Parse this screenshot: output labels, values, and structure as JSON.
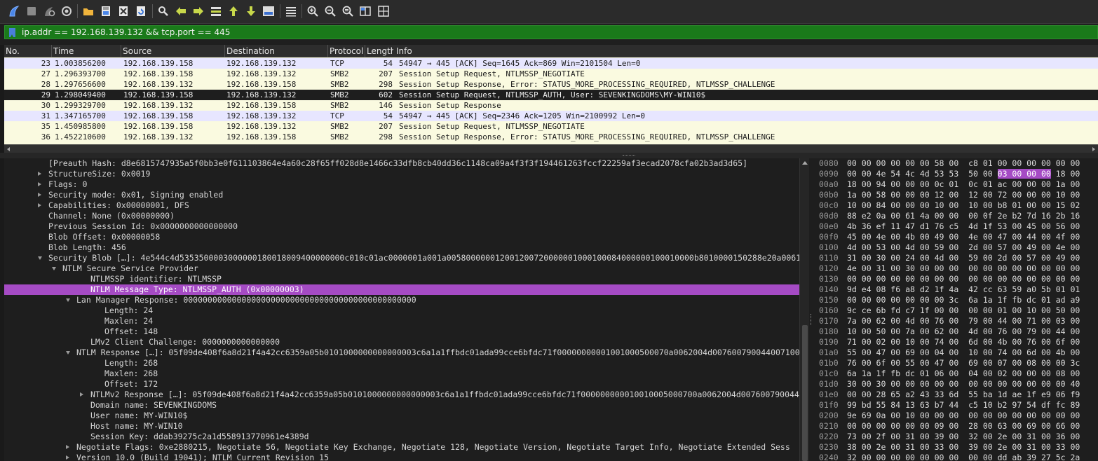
{
  "toolbar": {
    "buttons": [
      {
        "icon": "shark-fin-start-icon"
      },
      {
        "icon": "stop-capture-icon"
      },
      {
        "icon": "restart-capture-icon"
      },
      {
        "icon": "capture-options-icon"
      },
      {
        "icon": "open-file-icon"
      },
      {
        "icon": "save-file-icon"
      },
      {
        "icon": "close-file-icon"
      },
      {
        "icon": "reload-file-icon"
      },
      {
        "icon": "find-packet-icon"
      },
      {
        "icon": "go-back-icon"
      },
      {
        "icon": "go-forward-icon"
      },
      {
        "icon": "go-to-packet-icon"
      },
      {
        "icon": "go-first-packet-icon"
      },
      {
        "icon": "go-last-packet-icon"
      },
      {
        "icon": "auto-scroll-icon"
      },
      {
        "icon": "colorize-icon"
      },
      {
        "icon": "zoom-in-icon"
      },
      {
        "icon": "zoom-out-icon"
      },
      {
        "icon": "zoom-normal-icon"
      },
      {
        "icon": "resize-columns-icon"
      },
      {
        "icon": "expand-subtrees-icon"
      }
    ]
  },
  "filter": {
    "value": "ip.addr == 192.168.139.132 && tcp.port == 445",
    "background_color": "#1a7a1a"
  },
  "packet_list": {
    "columns": [
      "No.",
      "Time",
      "Source",
      "Destination",
      "Protocol",
      "Length",
      "Info"
    ],
    "rows": [
      {
        "no": "23",
        "time": "1.003856200",
        "source": "192.168.139.158",
        "destination": "192.168.139.132",
        "protocol": "TCP",
        "length": "54",
        "info": "54947 → 445 [ACK] Seq=1645 Ack=869 Win=2101504 Len=0",
        "kind": "tcp"
      },
      {
        "no": "27",
        "time": "1.296393700",
        "source": "192.168.139.158",
        "destination": "192.168.139.132",
        "protocol": "SMB2",
        "length": "207",
        "info": "Session Setup Request, NTLMSSP_NEGOTIATE",
        "kind": "smb"
      },
      {
        "no": "28",
        "time": "1.297656600",
        "source": "192.168.139.132",
        "destination": "192.168.139.158",
        "protocol": "SMB2",
        "length": "298",
        "info": "Session Setup Response, Error: STATUS_MORE_PROCESSING_REQUIRED, NTLMSSP_CHALLENGE",
        "kind": "smb"
      },
      {
        "no": "29",
        "time": "1.298049400",
        "source": "192.168.139.158",
        "destination": "192.168.139.132",
        "protocol": "SMB2",
        "length": "602",
        "info": "Session Setup Request, NTLMSSP_AUTH, User: SEVENKINGDOMS\\MY-WIN10$",
        "kind": "sel"
      },
      {
        "no": "30",
        "time": "1.299329700",
        "source": "192.168.139.132",
        "destination": "192.168.139.158",
        "protocol": "SMB2",
        "length": "146",
        "info": "Session Setup Response",
        "kind": "smb"
      },
      {
        "no": "31",
        "time": "1.347165700",
        "source": "192.168.139.158",
        "destination": "192.168.139.132",
        "protocol": "TCP",
        "length": "54",
        "info": "54947 → 445 [ACK] Seq=2346 Ack=1205 Win=2100992 Len=0",
        "kind": "tcp"
      },
      {
        "no": "35",
        "time": "1.450985800",
        "source": "192.168.139.158",
        "destination": "192.168.139.132",
        "protocol": "SMB2",
        "length": "207",
        "info": "Session Setup Request, NTLMSSP_NEGOTIATE",
        "kind": "smb"
      },
      {
        "no": "36",
        "time": "1.452210600",
        "source": "192.168.139.132",
        "destination": "192.168.139.158",
        "protocol": "SMB2",
        "length": "298",
        "info": "Session Setup Response, Error: STATUS_MORE_PROCESSING_REQUIRED, NTLMSSP_CHALLENGE",
        "kind": "smb"
      }
    ]
  },
  "details": {
    "rows": [
      {
        "indent": 1,
        "arrow": "none",
        "text": "[Preauth Hash: d8e6815747935a5f0bb3e0f611103864e4a60c28f65ff028d8e1466c33dfb8cb40dd36c1148ca09a4f3f3f194461263fccf22259af3ecad2078cfa02b3ad3d65]"
      },
      {
        "indent": 1,
        "arrow": "right",
        "text": "StructureSize: 0x0019"
      },
      {
        "indent": 1,
        "arrow": "right",
        "text": "Flags: 0"
      },
      {
        "indent": 1,
        "arrow": "right",
        "text": "Security mode: 0x01, Signing enabled"
      },
      {
        "indent": 1,
        "arrow": "right",
        "text": "Capabilities: 0x00000001, DFS"
      },
      {
        "indent": 1,
        "arrow": "none",
        "text": "Channel: None (0x00000000)"
      },
      {
        "indent": 1,
        "arrow": "none",
        "text": "Previous Session Id: 0x0000000000000000"
      },
      {
        "indent": 1,
        "arrow": "none",
        "text": "Blob Offset: 0x00000058"
      },
      {
        "indent": 1,
        "arrow": "none",
        "text": "Blob Length: 456"
      },
      {
        "indent": 1,
        "arrow": "down",
        "text": "Security Blob […]: 4e544c4d5353500003000000180018009400000000c010c01ac0000001a001a005800000012001200720000001000100084000000100010000b8010000150288e20a0061"
      },
      {
        "indent": 2,
        "arrow": "down",
        "text": "NTLM Secure Service Provider"
      },
      {
        "indent": 4,
        "arrow": "none",
        "text": "NTLMSSP identifier: NTLMSSP"
      },
      {
        "indent": 4,
        "arrow": "none",
        "text": "NTLM Message Type: NTLMSSP_AUTH (0x00000003)",
        "highlight": true
      },
      {
        "indent": 3,
        "arrow": "down",
        "text": "Lan Manager Response: 000000000000000000000000000000000000000000000000"
      },
      {
        "indent": 5,
        "arrow": "none",
        "text": "Length: 24"
      },
      {
        "indent": 5,
        "arrow": "none",
        "text": "Maxlen: 24"
      },
      {
        "indent": 5,
        "arrow": "none",
        "text": "Offset: 148"
      },
      {
        "indent": 4,
        "arrow": "none",
        "text": "LMv2 Client Challenge: 0000000000000000"
      },
      {
        "indent": 3,
        "arrow": "down",
        "text": "NTLM Response […]: 05f09de408f6a8d21f4a42cc6359a05b0101000000000000003c6a1a1ffbdc01ada99cce6bfdc71f00000000001001000500070a0062004d0076007900440071000"
      },
      {
        "indent": 5,
        "arrow": "none",
        "text": "Length: 268"
      },
      {
        "indent": 5,
        "arrow": "none",
        "text": "Maxlen: 268"
      },
      {
        "indent": 5,
        "arrow": "none",
        "text": "Offset: 172"
      },
      {
        "indent": 4,
        "arrow": "right",
        "text": "NTLMv2 Response […]: 05f09de408f6a8d21f4a42cc6359a05b0101000000000000003c6a1a1ffbdc01ada99cce6bfdc71f000000000010010005000700a0062004d007600790044007"
      },
      {
        "indent": 4,
        "arrow": "none",
        "text": "Domain name: SEVENKINGDOMS"
      },
      {
        "indent": 4,
        "arrow": "none",
        "text": "User name: MY-WIN10$"
      },
      {
        "indent": 4,
        "arrow": "none",
        "text": "Host name: MY-WIN10"
      },
      {
        "indent": 4,
        "arrow": "none",
        "text": "Session Key: ddab39275c2a1d558913770961e4389d"
      },
      {
        "indent": 3,
        "arrow": "right",
        "text": "Negotiate Flags: 0xe2880215, Negotiate 56, Negotiate Key Exchange, Negotiate 128, Negotiate Version, Negotiate Target Info, Negotiate Extended Sess"
      },
      {
        "indent": 3,
        "arrow": "right",
        "text": "Version 10.0 (Build 19041); NTLM Current Revision 15"
      }
    ]
  },
  "bytes": {
    "rows": [
      {
        "offset": "0080",
        "pre": "00 00 00 00 00 00 58 00  c8 01 00 00 00 00 00 00",
        "mark": "",
        "post": ""
      },
      {
        "offset": "0090",
        "pre": "00 00 4e 54 4c 4d 53 53  50 00 ",
        "mark": "03 00 00 00",
        "post": " 18 00"
      },
      {
        "offset": "00a0",
        "pre": "18 00 94 00 00 00 0c 01  0c 01 ac 00 00 00 1a 00",
        "mark": "",
        "post": ""
      },
      {
        "offset": "00b0",
        "pre": "1a 00 58 00 00 00 12 00  12 00 72 00 00 00 10 00",
        "mark": "",
        "post": ""
      },
      {
        "offset": "00c0",
        "pre": "10 00 84 00 00 00 10 00  10 00 b8 01 00 00 15 02",
        "mark": "",
        "post": ""
      },
      {
        "offset": "00d0",
        "pre": "88 e2 0a 00 61 4a 00 00  00 0f 2e b2 7d 16 2b 16",
        "mark": "",
        "post": ""
      },
      {
        "offset": "00e0",
        "pre": "4b 36 ef 11 47 d1 76 c5  4d 1f 53 00 45 00 56 00",
        "mark": "",
        "post": ""
      },
      {
        "offset": "00f0",
        "pre": "45 00 4e 00 4b 00 49 00  4e 00 47 00 44 00 4f 00",
        "mark": "",
        "post": ""
      },
      {
        "offset": "0100",
        "pre": "4d 00 53 00 4d 00 59 00  2d 00 57 00 49 00 4e 00",
        "mark": "",
        "post": ""
      },
      {
        "offset": "0110",
        "pre": "31 00 30 00 24 00 4d 00  59 00 2d 00 57 00 49 00",
        "mark": "",
        "post": ""
      },
      {
        "offset": "0120",
        "pre": "4e 00 31 00 30 00 00 00  00 00 00 00 00 00 00 00",
        "mark": "",
        "post": ""
      },
      {
        "offset": "0130",
        "pre": "00 00 00 00 00 00 00 00  00 00 00 00 00 00 00 00",
        "mark": "",
        "post": ""
      },
      {
        "offset": "0140",
        "pre": "9d e4 08 f6 a8 d2 1f 4a  42 cc 63 59 a0 5b 01 01",
        "mark": "",
        "post": ""
      },
      {
        "offset": "0150",
        "pre": "00 00 00 00 00 00 00 3c  6a 1a 1f fb dc 01 ad a9",
        "mark": "",
        "post": ""
      },
      {
        "offset": "0160",
        "pre": "9c ce 6b fd c7 1f 00 00  00 00 01 00 10 00 50 00",
        "mark": "",
        "post": ""
      },
      {
        "offset": "0170",
        "pre": "7a 00 62 00 4d 00 76 00  79 00 44 00 71 00 03 00",
        "mark": "",
        "post": ""
      },
      {
        "offset": "0180",
        "pre": "10 00 50 00 7a 00 62 00  4d 00 76 00 79 00 44 00",
        "mark": "",
        "post": ""
      },
      {
        "offset": "0190",
        "pre": "71 00 02 00 10 00 74 00  6d 00 4b 00 76 00 6f 00",
        "mark": "",
        "post": ""
      },
      {
        "offset": "01a0",
        "pre": "55 00 47 00 69 00 04 00  10 00 74 00 6d 00 4b 00",
        "mark": "",
        "post": ""
      },
      {
        "offset": "01b0",
        "pre": "76 00 6f 00 55 00 47 00  69 00 07 00 08 00 00 3c",
        "mark": "",
        "post": ""
      },
      {
        "offset": "01c0",
        "pre": "6a 1a 1f fb dc 01 06 00  04 00 02 00 00 00 08 00",
        "mark": "",
        "post": ""
      },
      {
        "offset": "01d0",
        "pre": "30 00 30 00 00 00 00 00  00 00 00 00 00 00 00 40",
        "mark": "",
        "post": ""
      },
      {
        "offset": "01e0",
        "pre": "00 00 28 65 a2 43 33 6d  55 ba 1d ae 1f e9 06 f9",
        "mark": "",
        "post": ""
      },
      {
        "offset": "01f0",
        "pre": "99 bd 55 84 13 63 b7 44  c5 10 b2 97 54 df fc 89",
        "mark": "",
        "post": ""
      },
      {
        "offset": "0200",
        "pre": "9e 69 0a 00 10 00 00 00  00 00 00 00 00 00 00 00",
        "mark": "",
        "post": ""
      },
      {
        "offset": "0210",
        "pre": "00 00 00 00 00 00 09 00  28 00 63 00 69 00 66 00",
        "mark": "",
        "post": ""
      },
      {
        "offset": "0220",
        "pre": "73 00 2f 00 31 00 39 00  32 00 2e 00 31 00 36 00",
        "mark": "",
        "post": ""
      },
      {
        "offset": "0230",
        "pre": "38 00 2e 00 31 00 33 00  39 00 2e 00 31 00 33 00",
        "mark": "",
        "post": ""
      },
      {
        "offset": "0240",
        "pre": "32 00 00 00 00 00 00 00  00 00 dd ab 39 27 5c 2a",
        "mark": "",
        "post": ""
      }
    ]
  }
}
